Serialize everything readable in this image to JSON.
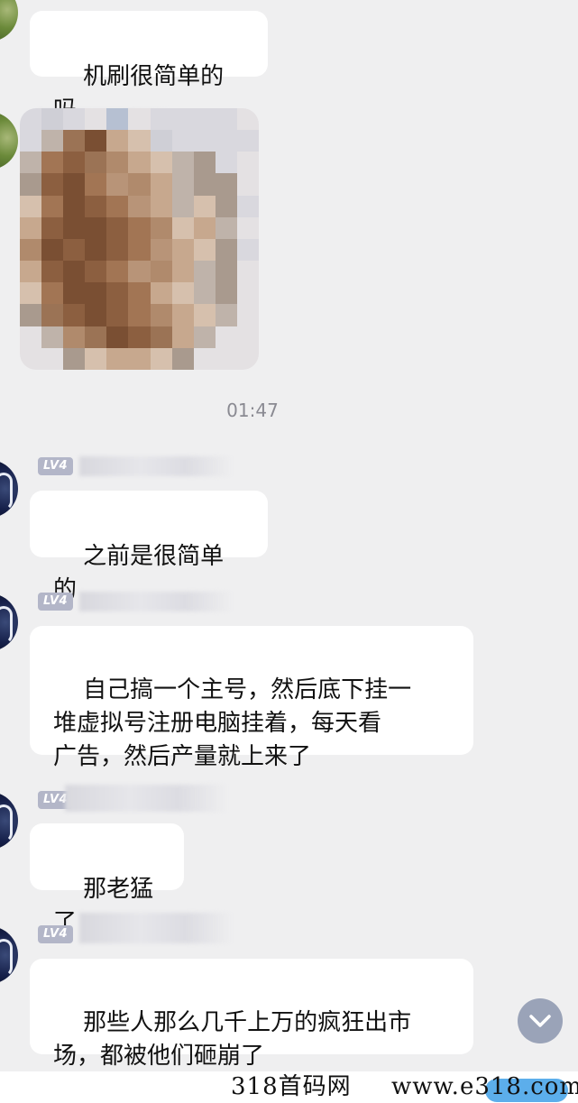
{
  "chat": {
    "timestamp": "01:47",
    "level_badge": "LV4",
    "messages": [
      {
        "text": "机刷很简单的吗"
      },
      {
        "text": "之前是很简单的"
      },
      {
        "text": "自己搞一个主号，然后底下挂一\n堆虚拟号注册电脑挂着，每天看\n广告，然后产量就上来了"
      },
      {
        "text": "那老猛了"
      },
      {
        "text": "那些人那么几千上万的疯狂出市\n场，都被他们砸崩了"
      }
    ],
    "image_message": {
      "content": "pixelated-image"
    }
  },
  "scroll_button": {
    "icon": "chevron-down-icon"
  },
  "watermark": {
    "left_text": "318首码网",
    "right_text": "www.e318.com"
  },
  "colors": {
    "background": "#efeff0",
    "bubble": "#ffffff",
    "badge": "#b3b6c8",
    "scroll_button": "#9aa3b8",
    "timestamp": "#8a8a92"
  }
}
